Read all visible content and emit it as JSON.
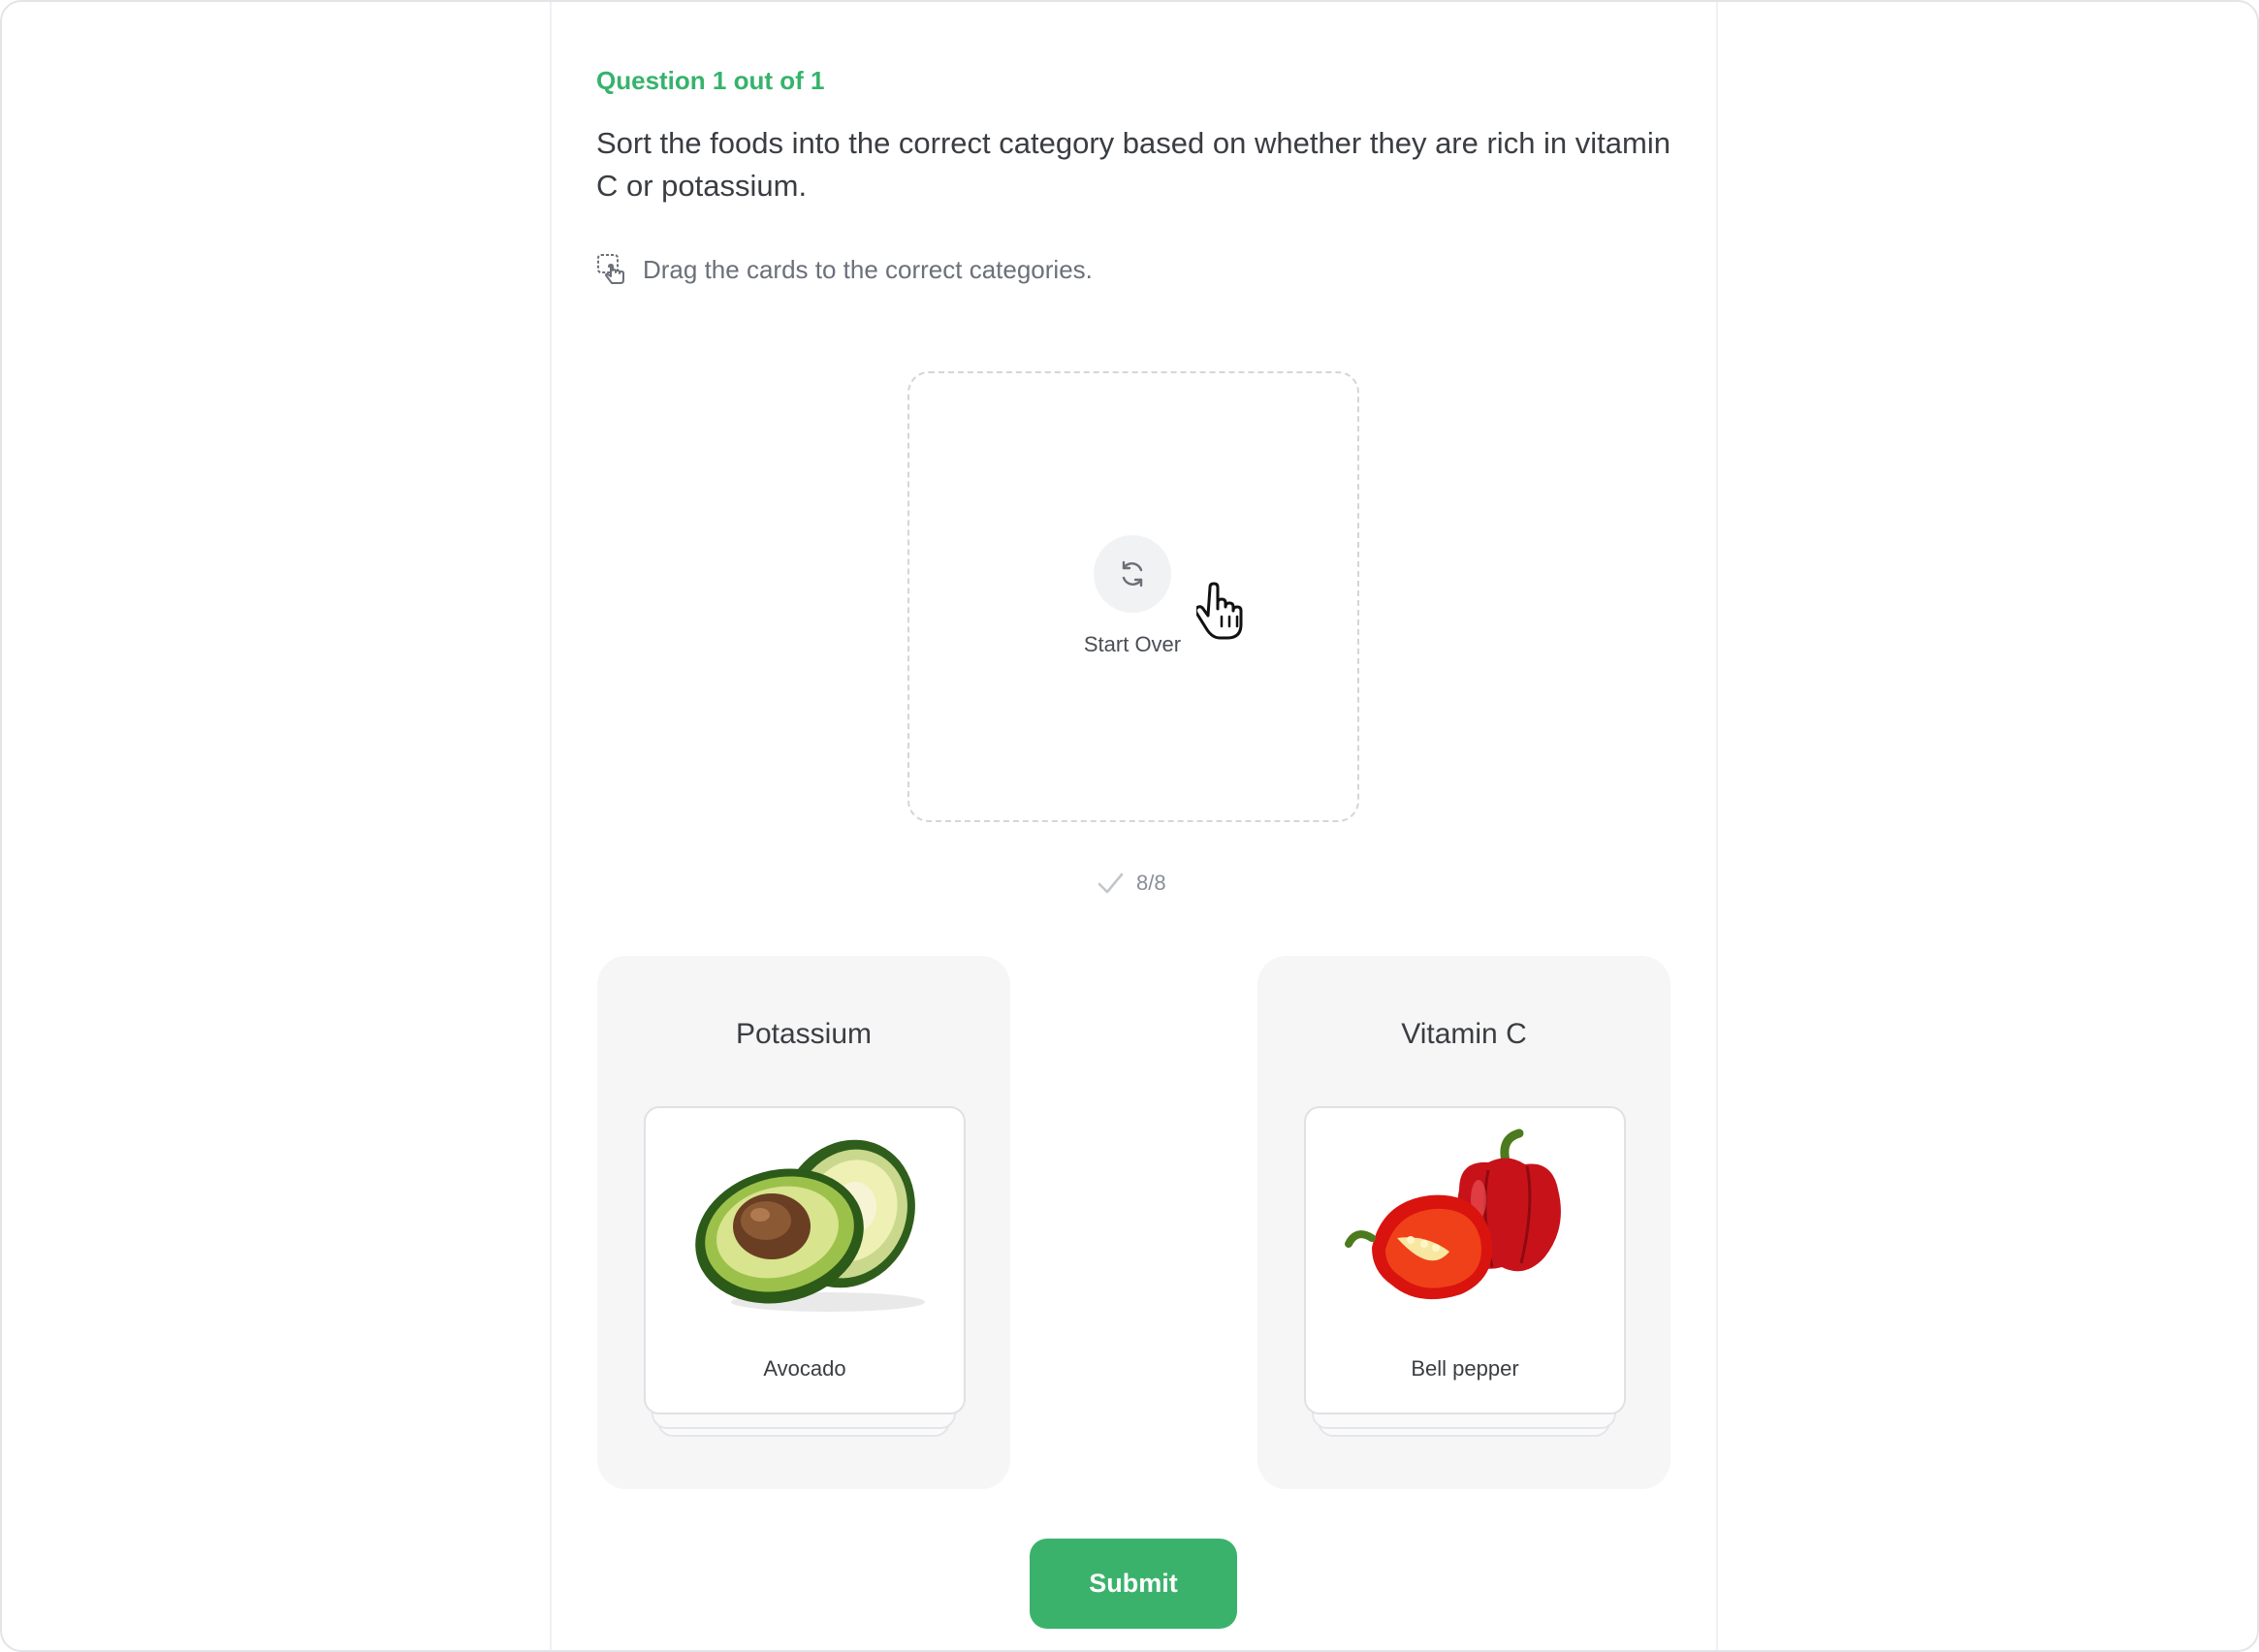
{
  "quiz": {
    "counter": "Question 1 out of 1",
    "question": "Sort the foods into the correct category based on whether they are rich in vitamin C or potassium.",
    "hint": "Drag the cards to the correct categories."
  },
  "dropzone": {
    "start_over_label": "Start Over",
    "progress": "8/8"
  },
  "categories": [
    {
      "title": "Potassium",
      "top_card": {
        "label": "Avocado",
        "icon": "avocado-image"
      }
    },
    {
      "title": "Vitamin C",
      "top_card": {
        "label": "Bell pepper",
        "icon": "bell-pepper-image"
      }
    }
  ],
  "submit_label": "Submit",
  "colors": {
    "accent": "#36b36c",
    "submit": "#3bb26c",
    "category_bg": "#f6f6f7"
  }
}
